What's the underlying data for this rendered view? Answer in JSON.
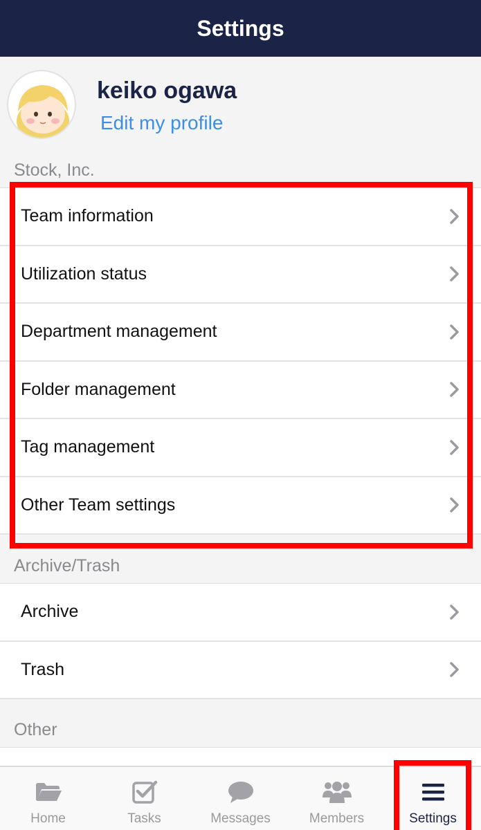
{
  "nav": {
    "title": "Settings"
  },
  "profile": {
    "name": "keiko ogawa",
    "edit_link": "Edit my profile"
  },
  "sections": [
    {
      "header": "Stock, Inc.",
      "items": [
        {
          "label": "Team information"
        },
        {
          "label": "Utilization status"
        },
        {
          "label": "Department management"
        },
        {
          "label": "Folder management"
        },
        {
          "label": "Tag management"
        },
        {
          "label": "Other Team settings"
        }
      ]
    },
    {
      "header": "Archive/Trash",
      "items": [
        {
          "label": "Archive"
        },
        {
          "label": "Trash"
        }
      ]
    },
    {
      "header": "Other",
      "items": []
    }
  ],
  "tab_bar": {
    "active": "Settings",
    "tabs": [
      {
        "label": "Home",
        "icon": "folder-icon"
      },
      {
        "label": "Tasks",
        "icon": "checkbox-icon"
      },
      {
        "label": "Messages",
        "icon": "speech-bubble-icon"
      },
      {
        "label": "Members",
        "icon": "people-icon"
      },
      {
        "label": "Settings",
        "icon": "hamburger-menu-icon"
      }
    ]
  },
  "colors": {
    "nav_background": "#1b2447",
    "link": "#3d8ee6",
    "highlight": "#ff0000",
    "inactive_tab": "#9a9a9e"
  }
}
